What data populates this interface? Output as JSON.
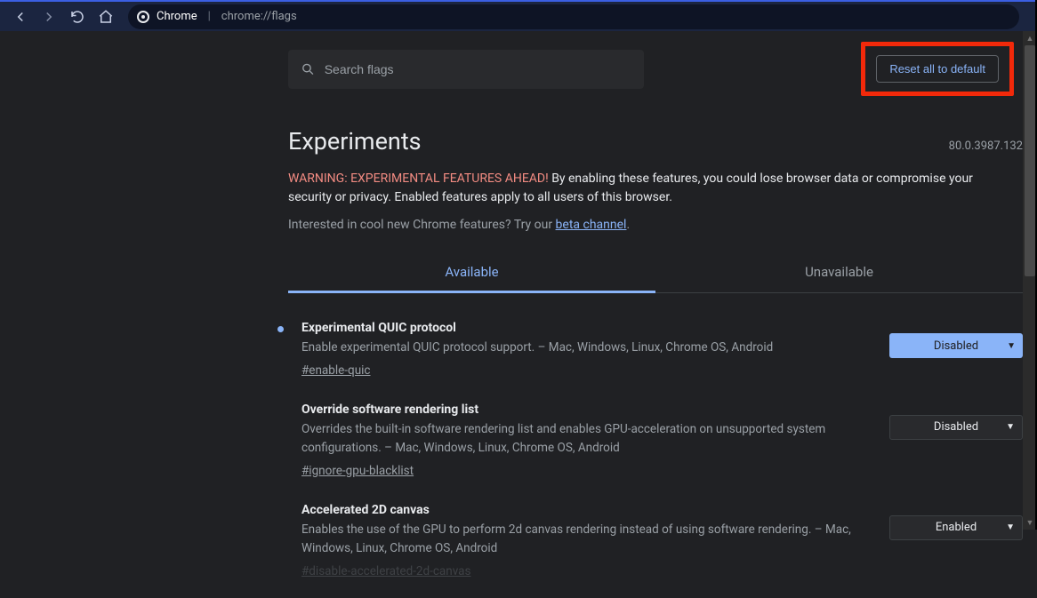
{
  "nav": {
    "origin": "Chrome",
    "path": "chrome://flags"
  },
  "search": {
    "placeholder": "Search flags"
  },
  "reset_label": "Reset all to default",
  "heading": "Experiments",
  "version": "80.0.3987.132",
  "warning_red": "WARNING: EXPERIMENTAL FEATURES AHEAD!",
  "warning_rest": " By enabling these features, you could lose browser data or compromise your security or privacy. Enabled features apply to all users of this browser.",
  "interested_prefix": "Interested in cool new Chrome features? Try our ",
  "interested_link": "beta channel",
  "interested_suffix": ".",
  "tabs": {
    "available": "Available",
    "unavailable": "Unavailable"
  },
  "flags": [
    {
      "modified": true,
      "title": "Experimental QUIC protocol",
      "desc": "Enable experimental QUIC protocol support. – Mac, Windows, Linux, Chrome OS, Android",
      "anchor": "#enable-quic",
      "value": "Disabled",
      "style": "blue"
    },
    {
      "modified": false,
      "title": "Override software rendering list",
      "desc": "Overrides the built-in software rendering list and enables GPU-acceleration on unsupported system configurations. – Mac, Windows, Linux, Chrome OS, Android",
      "anchor": "#ignore-gpu-blacklist",
      "value": "Disabled",
      "style": "dark"
    },
    {
      "modified": false,
      "title": "Accelerated 2D canvas",
      "desc": "Enables the use of the GPU to perform 2d canvas rendering instead of using software rendering. – Mac, Windows, Linux, Chrome OS, Android",
      "anchor": "#disable-accelerated-2d-canvas",
      "value": "Enabled",
      "style": "dark"
    }
  ]
}
